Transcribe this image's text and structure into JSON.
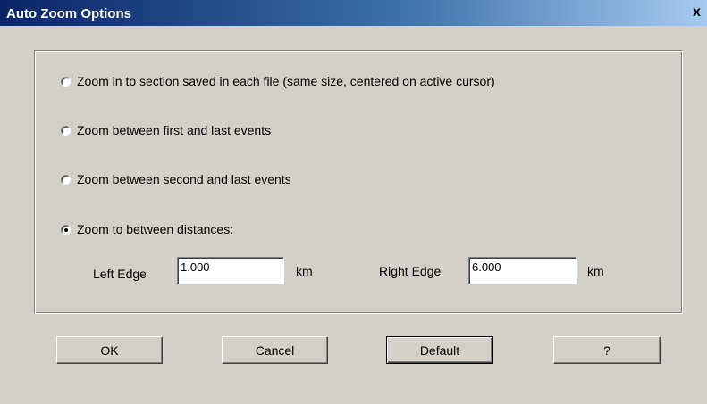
{
  "window": {
    "title": "Auto Zoom Options",
    "close_glyph": "x"
  },
  "options": [
    {
      "label": "Zoom in to section saved in each file (same size, centered on active cursor)",
      "checked": false
    },
    {
      "label": "Zoom between first and last events",
      "checked": false
    },
    {
      "label": "Zoom between second and last events",
      "checked": false
    },
    {
      "label": "Zoom to between distances:",
      "checked": true
    }
  ],
  "distances": {
    "left_label": "Left Edge",
    "left_value": "1.000",
    "left_unit": "km",
    "right_label": "Right Edge",
    "right_value": "6.000",
    "right_unit": "km"
  },
  "buttons": {
    "ok": "OK",
    "cancel": "Cancel",
    "default": "Default",
    "help": "?"
  }
}
